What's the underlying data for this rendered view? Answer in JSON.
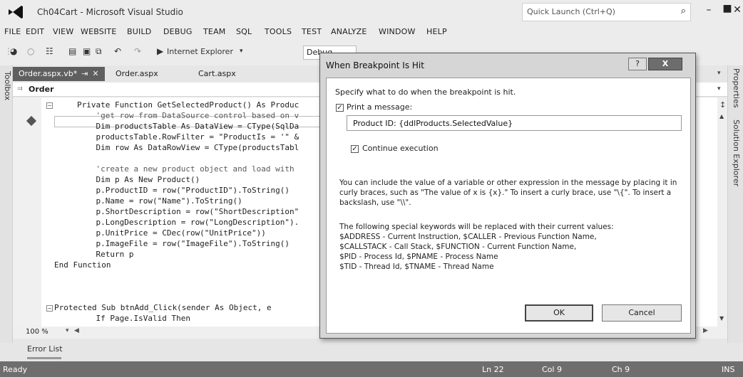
{
  "window": {
    "title": "Ch04Cart - Microsoft Visual Studio",
    "quick_launch_placeholder": "Quick Launch (Ctrl+Q)"
  },
  "menu": [
    "FILE",
    "EDIT",
    "VIEW",
    "WEBSITE",
    "BUILD",
    "DEBUG",
    "TEAM",
    "SQL",
    "TOOLS",
    "TEST",
    "ANALYZE",
    "WINDOW",
    "HELP"
  ],
  "toolbar": {
    "browser_label": "Internet Explorer",
    "config_value": "Debug"
  },
  "side": {
    "toolbox_label": "Toolbox",
    "properties_label": "Properties",
    "solution_explorer_label": "Solution Explorer"
  },
  "tabs": [
    {
      "label": "Order.aspx.vb*",
      "active": true
    },
    {
      "label": "Order.aspx",
      "active": false
    },
    {
      "label": "Cart.aspx",
      "active": false
    }
  ],
  "navbar": {
    "class_label": "Order"
  },
  "code": [
    "Private Function GetSelectedProduct() As Produc",
    "    'get row from DataSource control based on v",
    "    Dim productsTable As DataView = CType(SqlDa",
    "    productsTable.RowFilter = \"ProductIs = '\" &",
    "    Dim row As DataRowView = CType(productsTabl",
    "",
    "    'create a new product object and load with",
    "    Dim p As New Product()",
    "    p.ProductID = row(\"ProductID\").ToString()",
    "    p.Name = row(\"Name\").ToString()",
    "    p.ShortDescription = row(\"ShortDescription\"",
    "    p.LongDescription = row(\"LongDescription\").",
    "    p.UnitPrice = CDec(row(\"UnitPrice\"))",
    "    p.ImageFile = row(\"ImageFile\").ToString()",
    "    Return p",
    "End Function",
    "",
    "Protected Sub btnAdd_Click(sender As Object, e",
    "    If Page.IsValid Then"
  ],
  "editor": {
    "zoom": "100 %"
  },
  "bottom": {
    "error_list_label": "Error List"
  },
  "status": {
    "ready": "Ready",
    "line": "Ln 22",
    "col": "Col 9",
    "ch": "Ch 9",
    "mode": "INS"
  },
  "dialog": {
    "title": "When Breakpoint Is Hit",
    "help_button": "?",
    "close_button": "X",
    "instruction": "Specify what to do when the breakpoint is hit.",
    "print_message_label": "Print a message:",
    "print_message_checked": true,
    "message_value": "Product ID: {ddlProducts.SelectedValue}",
    "continue_label": "Continue execution",
    "continue_checked": true,
    "help_text": "You can include the value of a variable or other expression in the message by placing it in curly braces, such as \"The value of x is {x}.\" To insert a curly brace, use \"\\{\". To insert a backslash, use \"\\\\\".",
    "keywords_intro": "The following special keywords will be replaced with their current values:",
    "keywords": [
      "$ADDRESS - Current Instruction, $CALLER - Previous Function Name,",
      "$CALLSTACK - Call Stack, $FUNCTION - Current Function Name,",
      "$PID - Process Id, $PNAME - Process Name",
      "$TID - Thread Id, $TNAME - Thread Name"
    ],
    "ok_label": "OK",
    "cancel_label": "Cancel"
  }
}
